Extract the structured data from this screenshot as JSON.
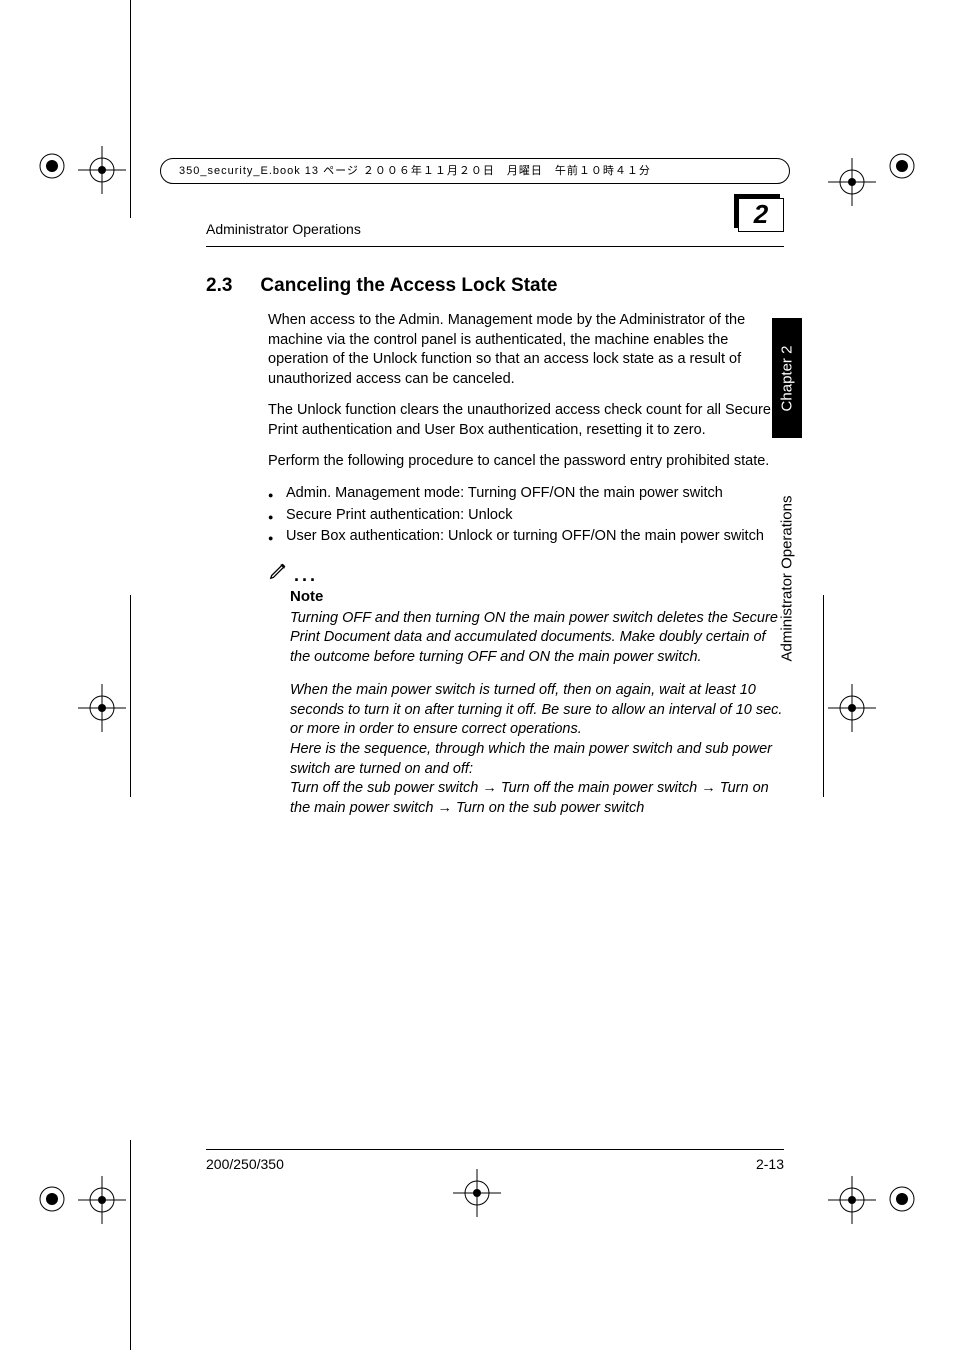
{
  "cropnote": "350_security_E.book  13 ページ  ２００６年１１月２０日　月曜日　午前１０時４１分",
  "running_head": "Administrator Operations",
  "chapter_badge": "2",
  "tab_chapter": "Chapter 2",
  "tab_section": "Administrator Operations",
  "section_number": "2.3",
  "section_title": "Canceling the Access Lock State",
  "para1": "When access to the Admin. Management mode by the Administrator of the machine via the control panel is authenticated, the machine enables the operation of the Unlock function so that an access lock state as a result of unauthorized access can be canceled.",
  "para2": "The Unlock function clears the unauthorized access check count for all Secure Print authentication and User Box authentication, resetting it to zero.",
  "para3": "Perform the following procedure to cancel the password entry prohibited state.",
  "bullets": {
    "b1": "Admin. Management mode: Turning OFF/ON the main power switch",
    "b2": "Secure Print authentication: Unlock",
    "b3": "User Box authentication: Unlock or turning OFF/ON the main power switch"
  },
  "note_label": "Note",
  "note_p1": "Turning OFF and then turning ON the main power switch deletes the Secure Print Document data and accumulated documents. Make doubly certain of the outcome before turning OFF and ON the main power switch.",
  "note_p2": "When the main power switch is turned off, then on again, wait at least 10 seconds to turn it on after turning it off. Be sure to allow an interval of 10 sec. or more in order to ensure correct operations.",
  "note_p3": "Here is the sequence, through which the main power switch and sub power switch are turned on and off:",
  "note_p4": "Turn off the sub power switch → Turn off the main power switch → Turn on the main power switch → Turn on the sub power switch",
  "footer_left": "200/250/350",
  "footer_right": "2-13"
}
